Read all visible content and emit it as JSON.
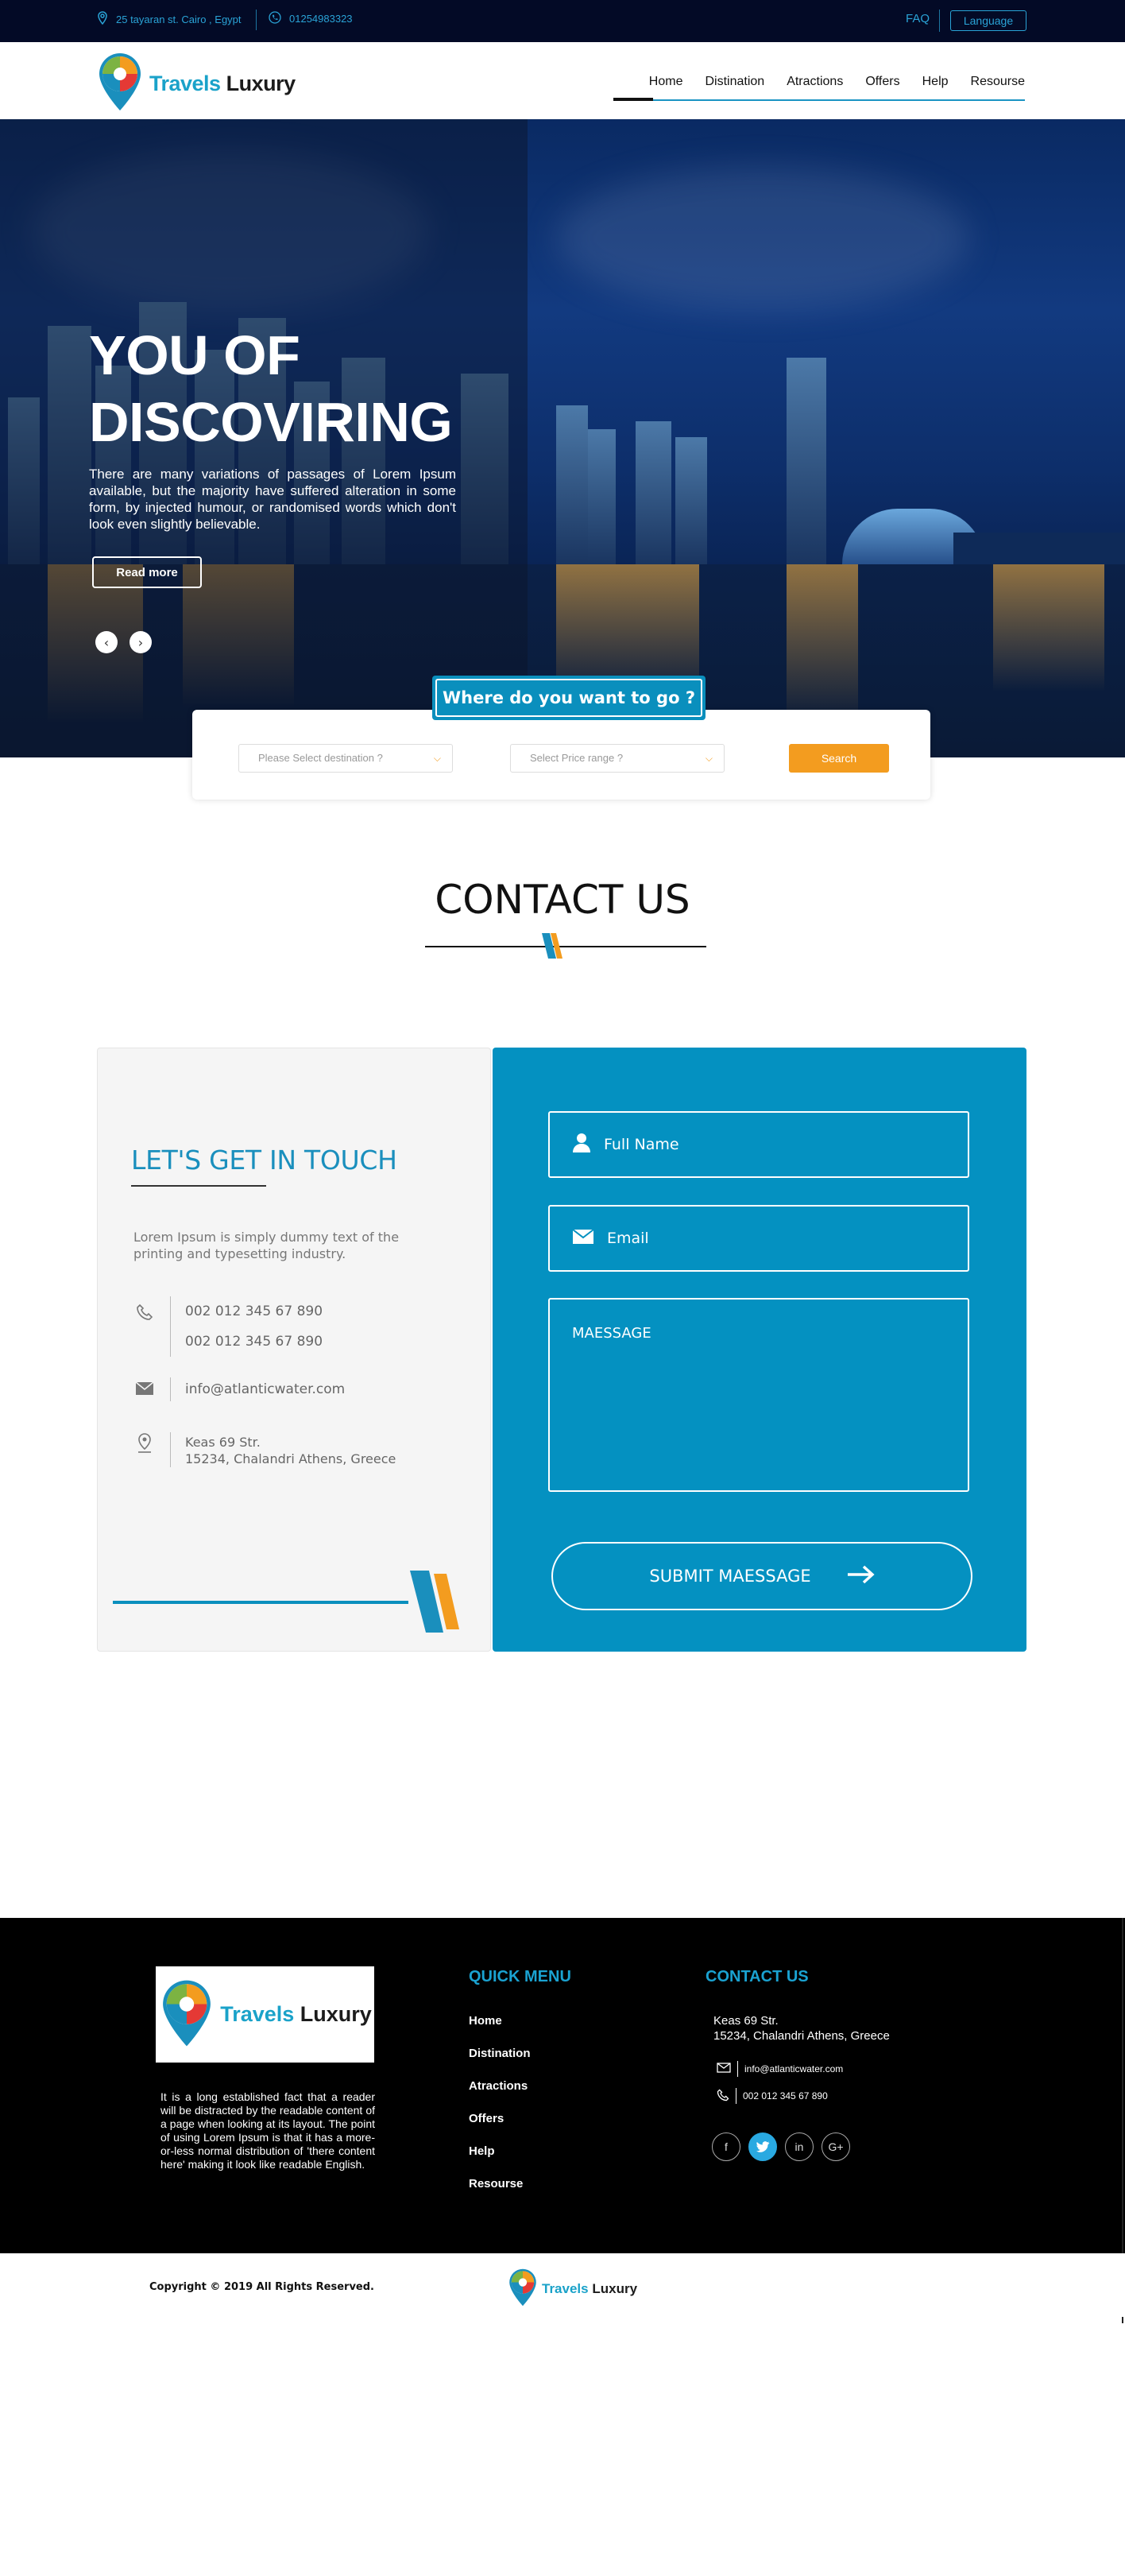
{
  "topbar": {
    "address": "25 tayaran st. Cairo , Egypt",
    "phone": "01254983323",
    "faq": "FAQ",
    "language": "Language"
  },
  "header": {
    "brand_part1": "Travels",
    "brand_part2": "Luxury",
    "nav": [
      "Home",
      "Distination",
      "Atractions",
      "Offers",
      "Help",
      "Resourse"
    ],
    "active": "Home"
  },
  "hero": {
    "title_line1": "YOU OF",
    "title_line2": "DISCOVIRING",
    "text": "There are many variations of passages of Lorem Ipsum available, but the majority have suffered alteration in some form, by injected humour, or randomised words which don't look even slightly believable.",
    "read_more": "Read more",
    "prev": "‹",
    "next": "›"
  },
  "search": {
    "heading": "Where do you want to go ?",
    "destination_placeholder": "Please Select destination ?",
    "price_placeholder": "Select Price range ?",
    "button": "Search"
  },
  "contact": {
    "title": "CONTACT US",
    "touch_title": "LET'S GET IN TOUCH",
    "description": "Lorem Ipsum is simply dummy text of the printing and typesetting industry.",
    "phone1": "002 012 345 67 890",
    "phone2": "002 012 345 67 890",
    "email": "info@atlanticwater.com",
    "address_line1": "Keas 69 Str.",
    "address_line2": "15234, Chalandri Athens, Greece",
    "form": {
      "full_name": "Full Name",
      "email": "Email",
      "message": "MAESSAGE",
      "submit": "SUBMIT MAESSAGE"
    },
    "colors": {
      "accent": "#0491c1",
      "orange": "#f39c1f"
    }
  },
  "footer": {
    "about": "It is a long established fact that a reader will be distracted by the readable content of a page when looking at its layout. The point of using Lorem Ipsum is that it has a more-or-less normal distribution of 'there content here' making it look like readable English.",
    "quick_menu_title": "QUICK MENU",
    "quick_menu": [
      "Home",
      "Distination",
      "Atractions",
      "Offers",
      "Help",
      "Resourse"
    ],
    "contact_title": "CONTACT US",
    "address_line1": "Keas 69 Str.",
    "address_line2": "15234, Chalandri Athens, Greece",
    "email": "info@atlanticwater.com",
    "phone": "002 012 345 67 890",
    "socials": [
      "f",
      "t",
      "in",
      "G+"
    ],
    "copyright": "Copyright © 2019 All Rights Reserved."
  }
}
